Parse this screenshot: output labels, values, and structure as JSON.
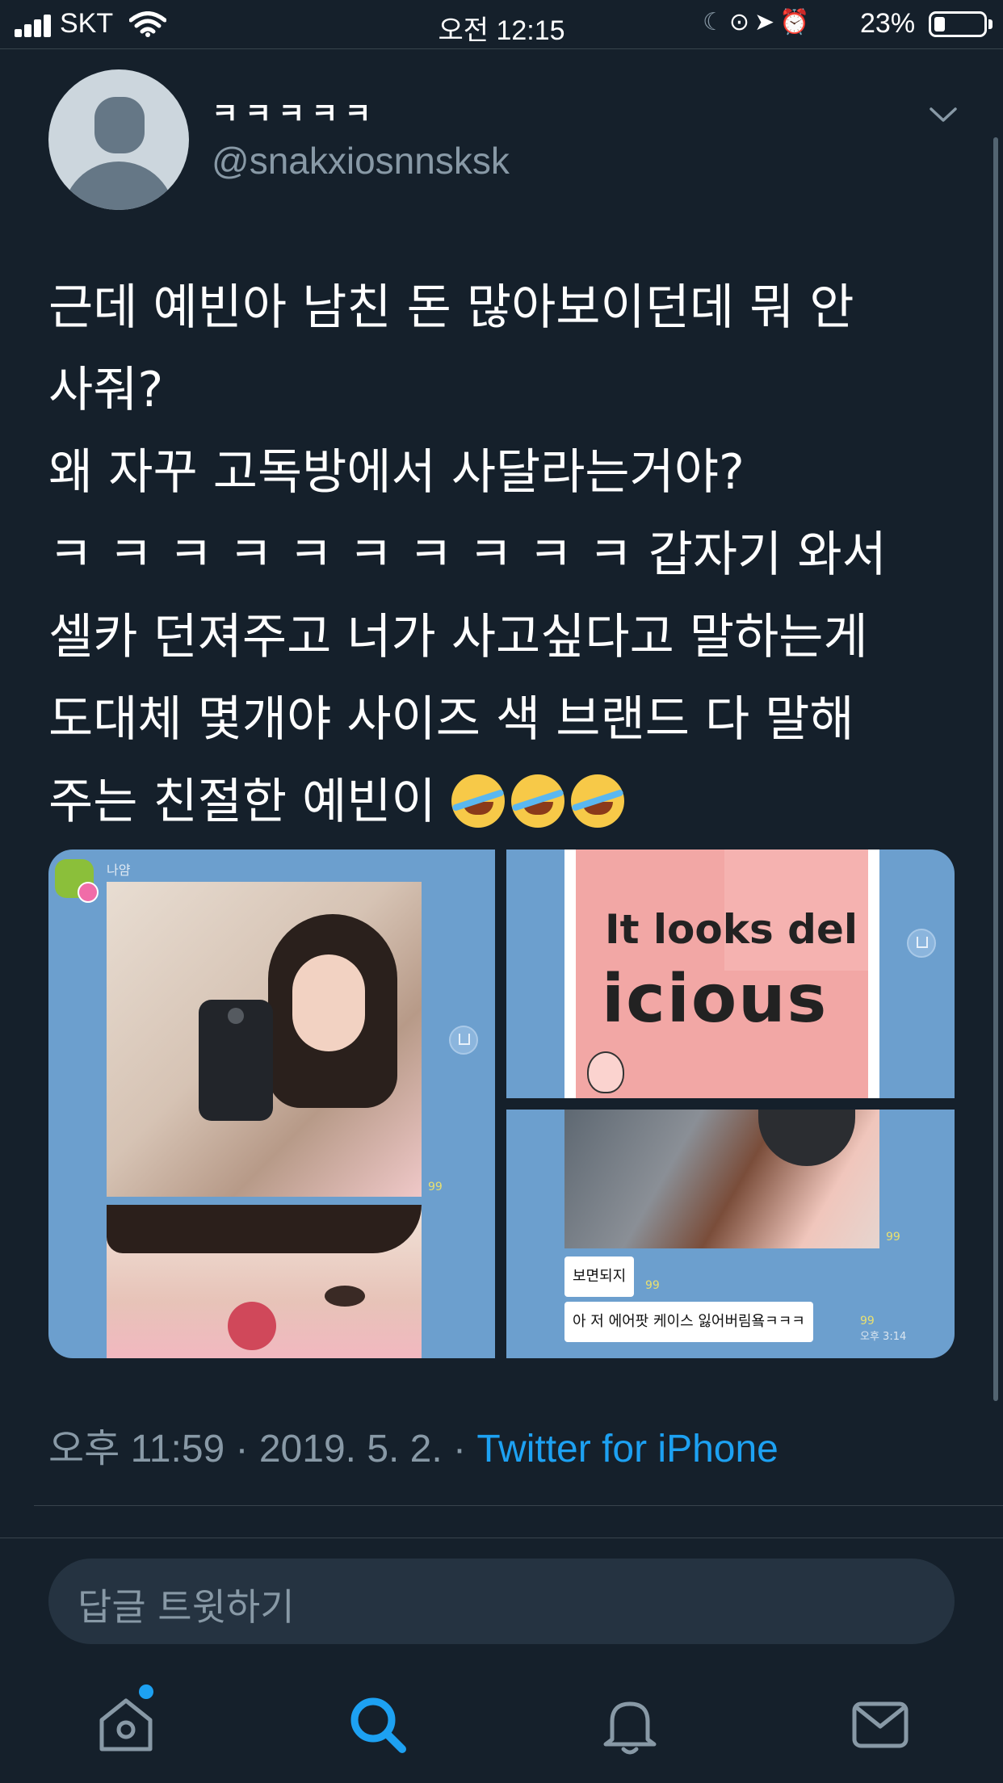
{
  "status_bar": {
    "carrier": "SKT",
    "time": "오전 12:15",
    "battery_percent": "23%",
    "battery_level": 0.23
  },
  "tweet": {
    "display_name": "ㅋㅋㅋㅋㅋ",
    "handle": "@snakxiosnnsksk",
    "text_lines": [
      "근데 예빈아 남친 돈 많아보이던데 뭐 안",
      "사줘?",
      "왜 자꾸 고독방에서 사달라는거야?",
      "ㅋ ㅋ ㅋ ㅋ ㅋ ㅋ ㅋ ㅋ ㅋ ㅋ 갑자기 와서",
      "셀카 던져주고 너가 사고싶다고 말하는게",
      "도대체 몇개야 사이즈 색 브랜드 다 말해",
      "주는 친절한 예빈이 "
    ],
    "emoji_name": "rolling-on-floor-laughing-emoji",
    "timestamp_text": "오후 11:59 · 2019. 5. 2. · ",
    "source": "Twitter for iPhone"
  },
  "media": {
    "panel1": {
      "sender_name": "나얌",
      "read_count": "99"
    },
    "panel2": {
      "line1": "It looks del",
      "line2": "icious"
    },
    "panel3": {
      "read_count_photo": "99",
      "bubble1": "보면되지",
      "bubble1_read": "99",
      "bubble2": "아 저 에어팟 케이스 잃어버림욬ㅋㅋㅋ",
      "bubble2_read": "99",
      "bubble2_time": "오후 3:14"
    }
  },
  "reply": {
    "placeholder": "답글 트윗하기"
  },
  "tab_bar": {
    "items": [
      "home-icon",
      "search-icon",
      "notifications-icon",
      "messages-icon"
    ],
    "active": "search-icon",
    "active_color": "#1da1f2",
    "inactive_color": "#8899a6"
  },
  "colors": {
    "background": "#15202b",
    "link": "#1da1f2",
    "secondary_text": "#8899a6"
  }
}
